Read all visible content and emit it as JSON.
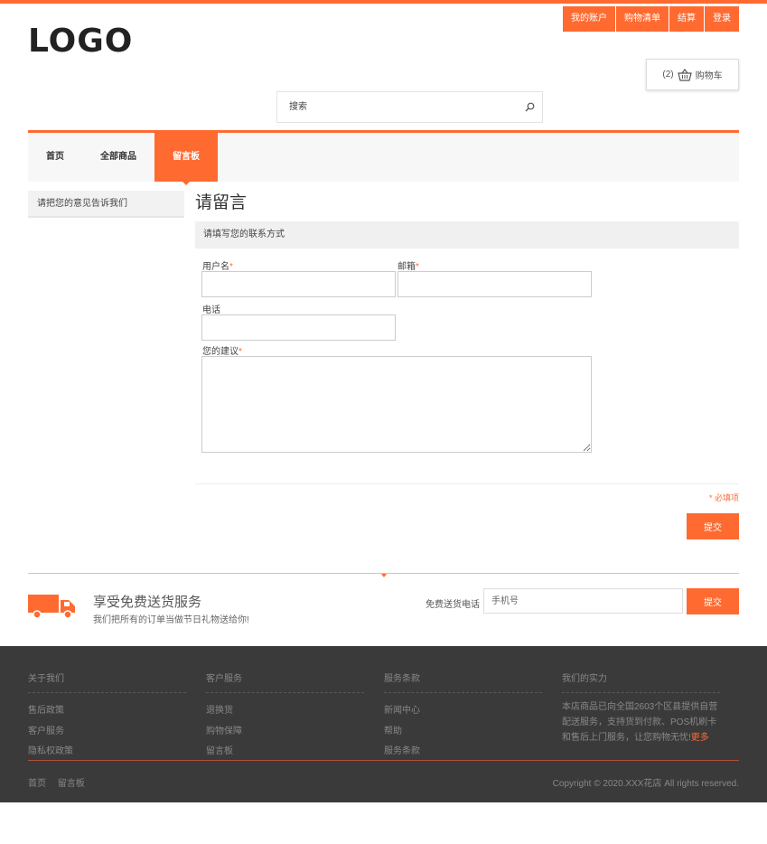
{
  "header": {
    "logo": "LOGO",
    "links": [
      "我的账户",
      "购物清单",
      "结算",
      "登录"
    ],
    "cart_count": "(2)",
    "cart_label": "购物车",
    "search_placeholder": "搜索"
  },
  "nav": {
    "items": [
      "首页",
      "全部商品",
      "留言板"
    ],
    "active_index": 2
  },
  "sidebar": {
    "item": "请把您的意见告诉我们"
  },
  "form": {
    "title": "请留言",
    "section_heading": "请填写您的联系方式",
    "username_label": "用户名",
    "email_label": "邮箱",
    "phone_label": "电话",
    "suggestion_label": "您的建议",
    "required_mark": "*",
    "required_note": "* 必填项",
    "submit_label": "提交"
  },
  "shipping": {
    "title": "享受免费送货服务",
    "subtitle": "我们把所有的订单当做节日礼物送给你!",
    "phone_label": "免费送货电话",
    "phone_placeholder": "手机号",
    "submit_label": "提交"
  },
  "footer": {
    "columns": [
      {
        "title": "关于我们",
        "items": [
          "售后政策",
          "客户服务",
          "隐私权政策"
        ]
      },
      {
        "title": "客户服务",
        "items": [
          "退换货",
          "购物保障",
          "留言板"
        ]
      },
      {
        "title": "服务条款",
        "items": [
          "新闻中心",
          "帮助",
          "服务条款"
        ]
      }
    ],
    "strength_title": "我们的实力",
    "strength_text": "本店商品已向全国2603个区县提供自营配送服务，支持货到付款、POS机刷卡和售后上门服务，让您购物无忧!",
    "strength_more": "更多",
    "bottom_links": [
      "首页",
      "留言板"
    ],
    "copyright": "Copyright © 2020.XXX花店 All rights reserved."
  },
  "colors": {
    "accent": "#ff6a30",
    "footer_bg": "#3a3a3a"
  }
}
